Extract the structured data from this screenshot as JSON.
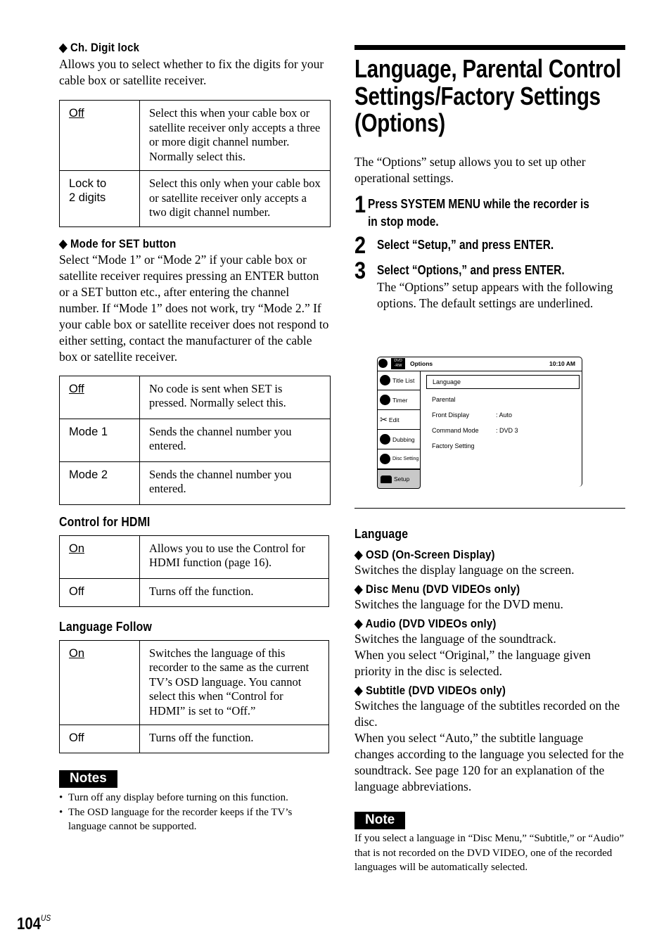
{
  "left": {
    "ch_digit_lock": {
      "heading": "◆ Ch. Digit lock",
      "intro": "Allows you to select whether to fix the digits for your cable box or satellite receiver.",
      "rows": [
        {
          "key": "Off",
          "default": true,
          "desc": "Select this when your cable box or satellite receiver only accepts a three or more digit channel number. Normally select this."
        },
        {
          "key": "Lock to 2 digits",
          "default": false,
          "desc": "Select this only when your cable box or satellite receiver only accepts a two digit channel number."
        }
      ]
    },
    "mode_set": {
      "heading": "◆ Mode for SET button",
      "intro": "Select “Mode 1” or “Mode 2” if your cable box or satellite receiver requires pressing an ENTER button or a SET button etc., after entering the channel number. If “Mode 1” does not work, try “Mode 2.” If your cable box or satellite receiver does not respond to either setting, contact the manufacturer of the cable box or satellite receiver.",
      "rows": [
        {
          "key": "Off",
          "default": true,
          "desc": "No code is sent when SET is pressed. Normally select this."
        },
        {
          "key": "Mode 1",
          "default": false,
          "desc": "Sends the channel number you entered."
        },
        {
          "key": "Mode 2",
          "default": false,
          "desc": "Sends the channel number you entered."
        }
      ]
    },
    "control_hdmi": {
      "heading": "Control for HDMI",
      "rows": [
        {
          "key": "On",
          "default": true,
          "desc": "Allows you to use the Control for HDMI function (page 16)."
        },
        {
          "key": "Off",
          "default": false,
          "desc": "Turns off the function."
        }
      ]
    },
    "language_follow": {
      "heading": "Language Follow",
      "rows": [
        {
          "key": "On",
          "default": true,
          "desc": "Switches the language of this recorder to the same as the current TV’s OSD language. You cannot select this when “Control for HDMI” is set to “Off.”"
        },
        {
          "key": "Off",
          "default": false,
          "desc": "Turns off the function."
        }
      ]
    },
    "notes": {
      "label": "Notes",
      "items": [
        "Turn off any display before turning on this function.",
        "The OSD language for the recorder keeps if the TV’s language cannot be supported."
      ]
    }
  },
  "right": {
    "title_lines": [
      "Language, Parental Control",
      "Settings/Factory Settings",
      "(Options)"
    ],
    "intro": "The “Options” setup allows you to set up other operational settings.",
    "steps": [
      {
        "num": "1",
        "lines": [
          "Press SYSTEM MENU while the recorder is",
          "in stop mode."
        ]
      },
      {
        "num": "2",
        "lines": [
          "Select “Setup,” and press ENTER."
        ]
      },
      {
        "num": "3",
        "lines": [
          "Select “Options,” and press ENTER."
        ],
        "detail": "The “Options” setup appears with the following options. The default settings are underlined."
      }
    ],
    "osd": {
      "disc_badge": "DVD -RW",
      "title": "Options",
      "time": "10:10 AM",
      "sidebar": [
        "Title List",
        "Timer",
        "Edit",
        "Dubbing",
        "Disc Setting",
        "Setup"
      ],
      "sidebar_selected": "Setup",
      "menu": [
        {
          "label": "Language",
          "value": ""
        },
        {
          "label": "Parental",
          "value": ""
        },
        {
          "label": "Front Display",
          "value": ":  Auto"
        },
        {
          "label": "Command Mode",
          "value": ":  DVD 3"
        },
        {
          "label": "Factory Setting",
          "value": ""
        }
      ],
      "menu_selected": "Language"
    },
    "language": {
      "heading": "Language",
      "items": [
        {
          "heading": "◆ OSD (On-Screen Display)",
          "text": "Switches the display language on the screen."
        },
        {
          "heading": "◆ Disc Menu (DVD VIDEOs only)",
          "text": "Switches the language for the DVD menu."
        },
        {
          "heading": "◆ Audio (DVD VIDEOs only)",
          "text": "Switches the language of the soundtrack.\nWhen you select “Original,” the language given priority in the disc is selected."
        },
        {
          "heading": "◆ Subtitle (DVD VIDEOs only)",
          "text": "Switches the language of the subtitles recorded on the disc.\nWhen you select “Auto,” the subtitle language changes according to the language you selected for the soundtrack. See page 120 for an explanation of the language abbreviations."
        }
      ]
    },
    "note": {
      "label": "Note",
      "text": "If you select a language in “Disc Menu,” “Subtitle,” or “Audio” that is not recorded on the DVD VIDEO, one of the recorded languages will be automatically selected."
    }
  },
  "footer": {
    "page": "104",
    "suffix": "US"
  }
}
